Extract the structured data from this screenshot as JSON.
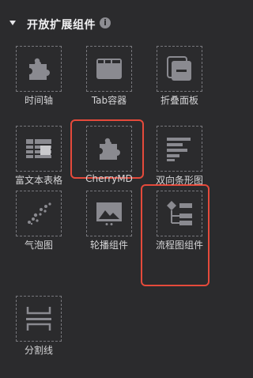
{
  "section": {
    "title": "开放扩展组件",
    "info_icon": "info-icon"
  },
  "components": [
    {
      "label": "时间轴",
      "icon": "puzzle-icon",
      "selected": false
    },
    {
      "label": "Tab容器",
      "icon": "tab-container-icon",
      "selected": false
    },
    {
      "label": "折叠面板",
      "icon": "collapse-panel-icon",
      "selected": false
    },
    {
      "label": "富文本表格",
      "icon": "rich-text-table-icon",
      "selected": false
    },
    {
      "label": "CherryMD",
      "icon": "puzzle-icon",
      "selected": true
    },
    {
      "label": "双向条形图",
      "icon": "bidirectional-bar-chart-icon",
      "selected": false
    },
    {
      "label": "气泡图",
      "icon": "bubble-chart-icon",
      "selected": false
    },
    {
      "label": "轮播组件",
      "icon": "carousel-icon",
      "selected": false
    },
    {
      "label": "流程图组件",
      "icon": "flowchart-icon",
      "selected": true
    },
    {
      "label": "分割线",
      "icon": "divider-icon",
      "selected": false
    }
  ],
  "colors": {
    "background": "#2b2b2d",
    "highlight": "#e54a3b",
    "icon": "#8a8a90"
  }
}
